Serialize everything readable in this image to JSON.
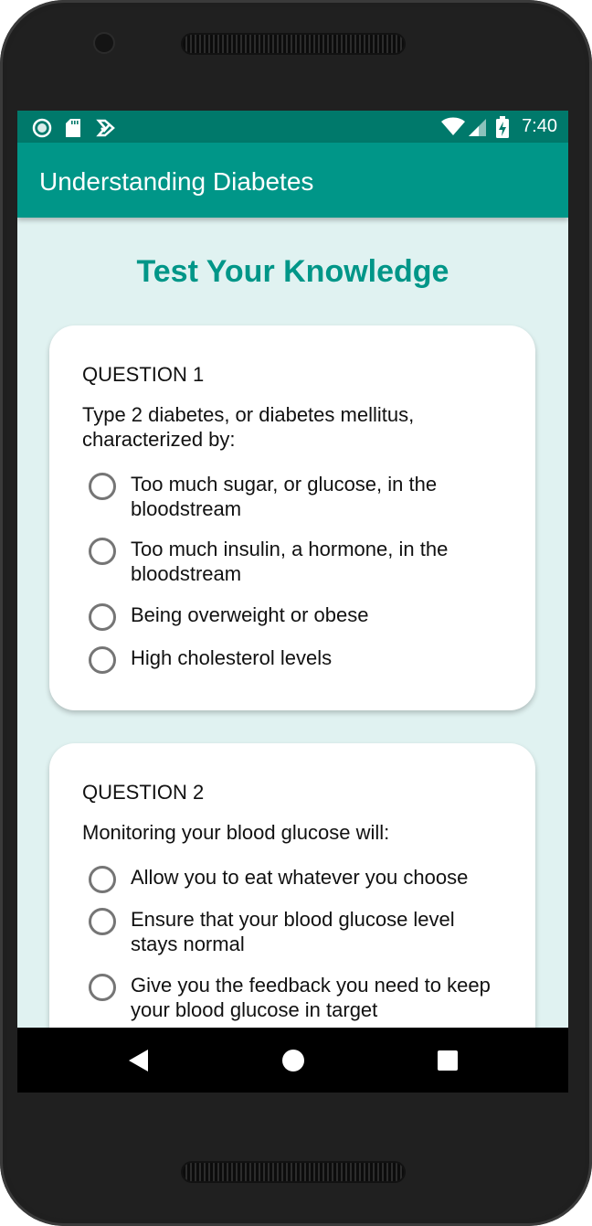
{
  "status_bar": {
    "time": "7:40",
    "left_icons": [
      "circle-notification-icon",
      "sd-card-icon",
      "download-check-icon"
    ],
    "right_icons": [
      "wifi-icon",
      "cellular-signal-icon",
      "battery-charging-icon"
    ]
  },
  "app_bar": {
    "title": "Understanding Diabetes"
  },
  "page": {
    "heading": "Test Your Knowledge"
  },
  "questions": [
    {
      "label": "QUESTION 1",
      "text": "Type 2 diabetes, or diabetes mellitus, characterized by:",
      "options": [
        "Too much sugar, or glucose, in the bloodstream",
        "Too much insulin, a hormone, in the bloodstream",
        "Being overweight or obese",
        "High cholesterol levels"
      ]
    },
    {
      "label": "QUESTION 2",
      "text": "Monitoring your blood glucose will:",
      "options": [
        "Allow you to eat whatever you choose",
        "Ensure that your blood glucose level stays normal",
        "Give you the feedback you need to keep your blood glucose in target"
      ]
    }
  ],
  "nav_bar": {
    "buttons": [
      "back-icon",
      "home-icon",
      "recents-icon"
    ]
  },
  "colors": {
    "status_bar": "#00796b",
    "app_bar": "#009688",
    "accent": "#009688",
    "background": "#e0f2f1"
  }
}
